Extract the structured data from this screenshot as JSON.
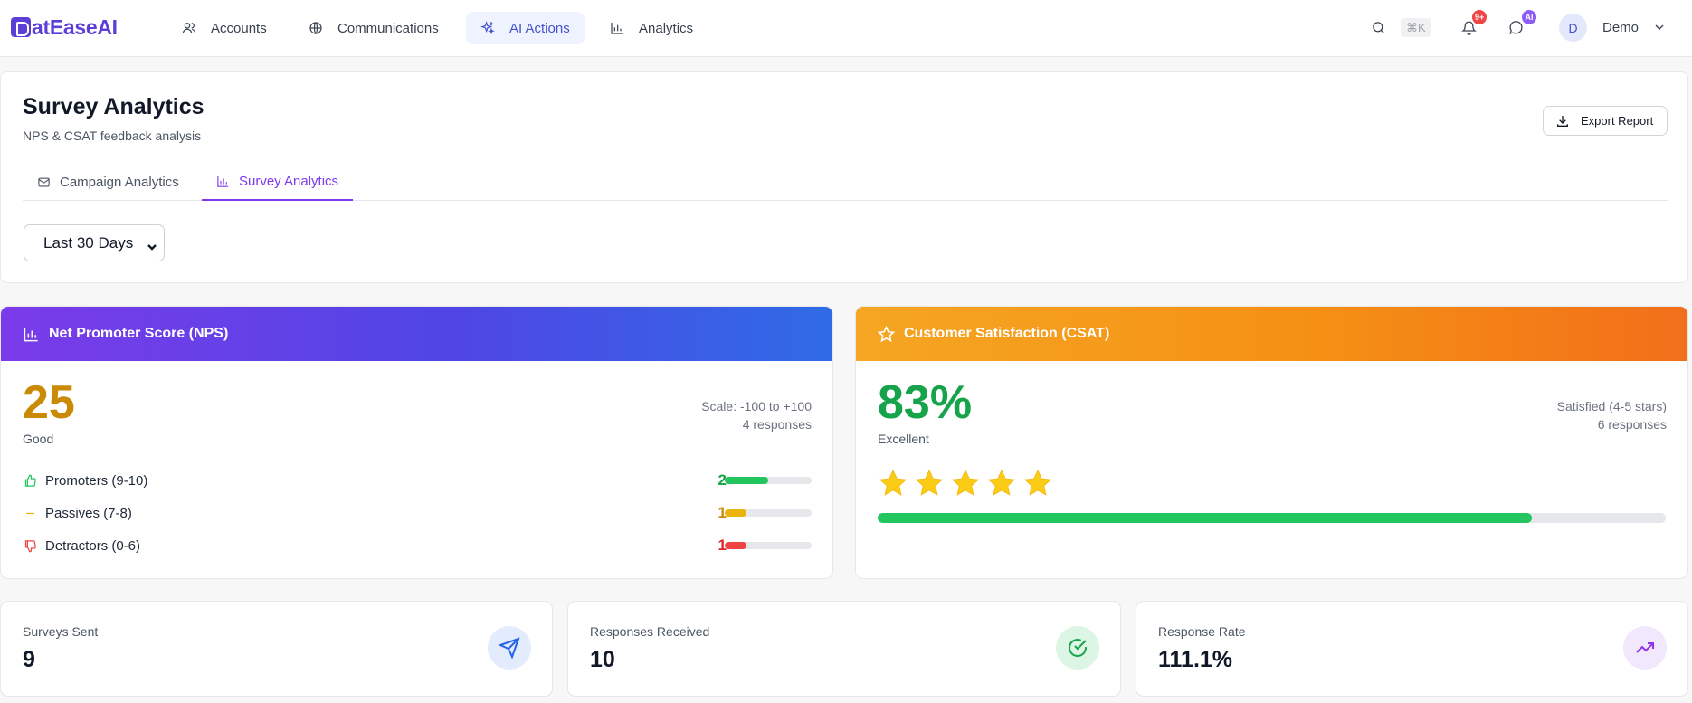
{
  "brand": {
    "name": "atEaseAI"
  },
  "nav": {
    "items": [
      {
        "label": "Accounts",
        "icon": "users-icon"
      },
      {
        "label": "Communications",
        "icon": "globe-icon"
      },
      {
        "label": "AI Actions",
        "icon": "sparkles-icon",
        "active": true
      },
      {
        "label": "Analytics",
        "icon": "bar-chart-icon"
      }
    ],
    "search_shortcut": "⌘K",
    "notifications_badge": "9+",
    "messages_badge": "AI",
    "user": {
      "initial": "D",
      "name": "Demo"
    }
  },
  "page": {
    "title": "Survey Analytics",
    "subtitle": "NPS & CSAT feedback analysis",
    "export_label": "Export Report",
    "tabs": [
      {
        "label": "Campaign Analytics",
        "icon": "mail-icon"
      },
      {
        "label": "Survey Analytics",
        "icon": "bar-chart-icon",
        "active": true
      }
    ],
    "date_range": "Last 30 Days"
  },
  "nps": {
    "header": "Net Promoter Score (NPS)",
    "score": "25",
    "rating": "Good",
    "scale": "Scale: -100 to +100",
    "responses": "4 responses",
    "rows": [
      {
        "label": "Promoters (9-10)",
        "count": "2",
        "fraction": 0.5,
        "color": "#22c55e",
        "icon": "thumbs-up-icon"
      },
      {
        "label": "Passives (7-8)",
        "count": "1",
        "fraction": 0.25,
        "color": "#eab308",
        "icon": "minus-icon"
      },
      {
        "label": "Detractors (0-6)",
        "count": "1",
        "fraction": 0.25,
        "color": "#ef4444",
        "icon": "thumbs-down-icon"
      }
    ],
    "score_color": "#ca8a04"
  },
  "csat": {
    "header": "Customer Satisfaction (CSAT)",
    "score": "83%",
    "rating": "Excellent",
    "satisfied": "Satisfied (4-5 stars)",
    "responses": "6 responses",
    "stars": 5,
    "fraction": 0.83,
    "score_color": "#16a34a"
  },
  "stats": [
    {
      "label": "Surveys Sent",
      "value": "9",
      "icon": "send-icon",
      "tint": "#e3ecfd",
      "color": "#2563eb"
    },
    {
      "label": "Responses Received",
      "value": "10",
      "icon": "check-circle-icon",
      "tint": "#dcf5e5",
      "color": "#16a34a"
    },
    {
      "label": "Response Rate",
      "value": "111.1%",
      "icon": "trending-up-icon",
      "tint": "#f1e8fd",
      "color": "#9333ea"
    }
  ]
}
